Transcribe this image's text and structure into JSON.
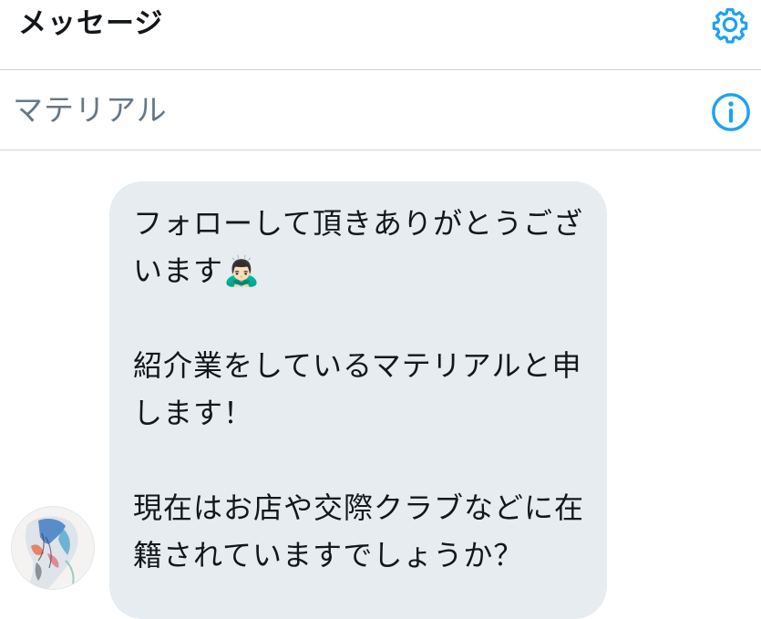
{
  "header": {
    "title": "メッセージ",
    "settings_icon": "gear-icon"
  },
  "conversation_header": {
    "name": "マテリアル",
    "info_icon": "info-icon"
  },
  "message": {
    "paragraphs": [
      "フォローして頂きありがとうございます🙇🏻‍♂️",
      "紹介業をしているマテリアルと申します！",
      "現在はお店や交際クラブなどに在籍されていますでしょうか？"
    ]
  },
  "avatar": {
    "icon": "avatar"
  },
  "colors": {
    "accent": "#1da1f2",
    "bubble_bg": "#e6ecf0",
    "muted_text": "#657786",
    "divider": "#cfd2d6",
    "text": "#14171a"
  }
}
